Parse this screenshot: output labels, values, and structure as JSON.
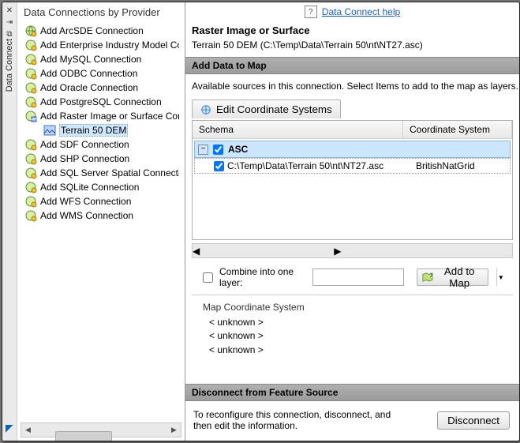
{
  "sidebar": {
    "title": "Data Connect"
  },
  "help": {
    "link": "Data Connect help"
  },
  "left": {
    "title": "Data Connections by Provider",
    "items": [
      "Add ArcSDE Connection",
      "Add Enterprise Industry Model Connection",
      "Add MySQL Connection",
      "Add ODBC Connection",
      "Add Oracle Connection",
      "Add PostgreSQL Connection",
      "Add Raster Image or Surface Connection",
      "Add SDF Connection",
      "Add SHP Connection",
      "Add SQL Server Spatial Connection",
      "Add SQLite Connection",
      "Add WFS Connection",
      "Add WMS Connection"
    ],
    "raster_child": "Terrain 50 DEM"
  },
  "right": {
    "title": "Raster Image or Surface",
    "path": "Terrain 50 DEM (C:\\Temp\\Data\\Terrain 50\\nt\\NT27.asc)",
    "section_add": "Add Data to Map",
    "available": "Available sources in this connection.   Select Items to add to the map as layers.",
    "edit_cs": "Edit Coordinate Systems",
    "grid": {
      "col_schema": "Schema",
      "col_cs": "Coordinate System",
      "group": "ASC",
      "row_path": "C:\\Temp\\Data\\Terrain 50\\nt\\NT27.asc",
      "row_cs": "BritishNatGrid"
    },
    "combine": "Combine into one layer:",
    "add_to_map": "Add to Map",
    "mapcs_label": "Map Coordinate System",
    "unknown": "< unknown >",
    "section_disconnect": "Disconnect from Feature Source",
    "disconnect_desc": "To reconfigure this connection, disconnect, and then edit the information.",
    "disconnect_btn": "Disconnect"
  }
}
